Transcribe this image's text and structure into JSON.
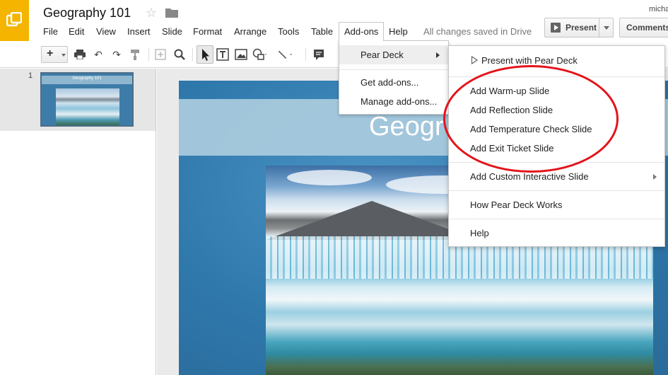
{
  "app": {
    "doc_title": "Geography 101",
    "user_name": "micha",
    "save_status": "All changes saved in Drive",
    "present_label": "Present",
    "comments_label": "Comments"
  },
  "menu": [
    "File",
    "Edit",
    "View",
    "Insert",
    "Slide",
    "Format",
    "Arrange",
    "Tools",
    "Table",
    "Add-ons",
    "Help"
  ],
  "toolbar_icons": [
    "new-slide",
    "print",
    "undo",
    "redo",
    "paint-format",
    "background",
    "zoom",
    "select",
    "text-box",
    "image",
    "shape",
    "line",
    "comment"
  ],
  "filmstrip": {
    "slide_number": "1",
    "thumb_title": "Geography 101"
  },
  "slide": {
    "title_visible": "Geogr"
  },
  "addons_menu": {
    "peardeck": "Pear Deck",
    "get_addons": "Get add-ons...",
    "manage_addons": "Manage add-ons..."
  },
  "peardeck_menu": {
    "present": "Present with Pear Deck",
    "warmup": "Add Warm-up Slide",
    "reflection": "Add Reflection Slide",
    "temperature": "Add Temperature Check Slide",
    "exit_ticket": "Add Exit Ticket Slide",
    "custom": "Add Custom Interactive Slide",
    "how_works": "How Pear Deck Works",
    "help": "Help"
  },
  "colors": {
    "logo": "#f4b400",
    "annotation": "#e3141b",
    "slide_blue": "#2f78ac"
  }
}
